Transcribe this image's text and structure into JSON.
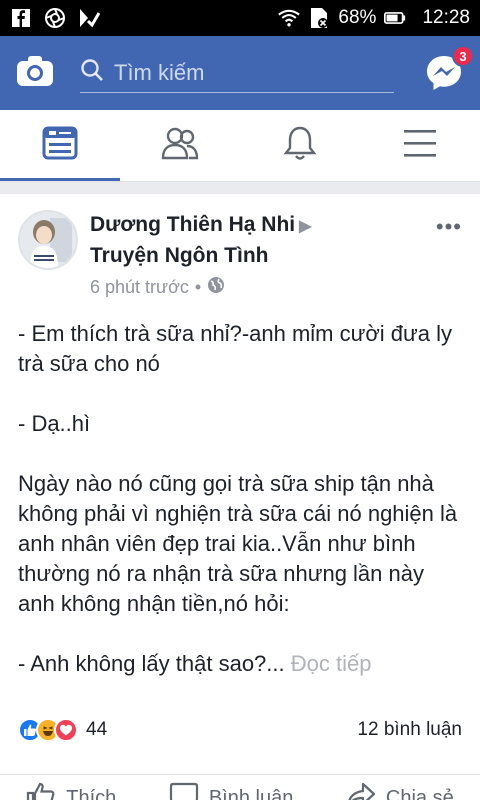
{
  "status": {
    "battery": "68%",
    "time": "12:28"
  },
  "search": {
    "placeholder": "Tìm kiếm"
  },
  "messenger": {
    "badge": "3"
  },
  "post": {
    "author_line1": "Dương Thiên Hạ Nhi",
    "author_line2": "Truyện Ngôn Tình",
    "time": "6 phút trước",
    "more": "•••",
    "paragraphs": [
      "- Em thích trà sữa nhỉ?-anh mỉm cười đưa ly trà sữa cho nó",
      "- Dạ..hì",
      "Ngày nào nó cũng gọi trà sữa ship tận nhà không phải vì nghiện trà sữa cái nó nghiện là anh nhân viên đẹp trai kia..Vẫn như bình thường nó ra nhận trà sữa nhưng lần này anh không nhận tiền,nó hỏi:",
      "- Anh không lấy thật sao?..."
    ],
    "read_more": "Đọc tiếp",
    "reaction_count": "44",
    "comments": "12 bình luận"
  },
  "actions": {
    "like": "Thích",
    "comment": "Bình luận",
    "share": "Chia sẻ"
  },
  "colors": {
    "brand": "#4267b2",
    "badge": "#f02849"
  }
}
